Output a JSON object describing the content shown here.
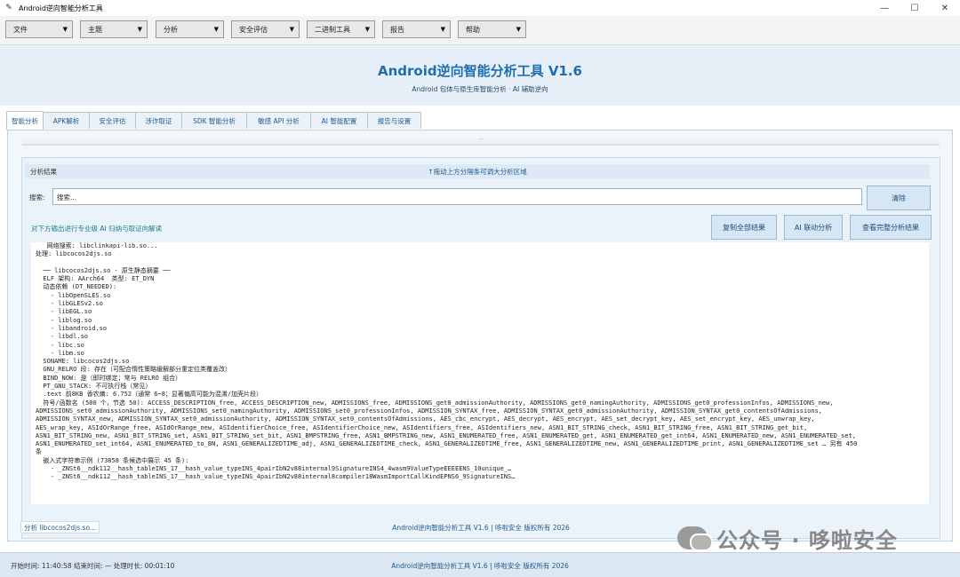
{
  "window": {
    "title": "Android逆向智能分析工具",
    "icon": "feather-icon",
    "controls": [
      "—",
      "☐",
      "✕"
    ]
  },
  "menubar": [
    {
      "label": "文件"
    },
    {
      "label": "主题"
    },
    {
      "label": "分析"
    },
    {
      "label": "安全评估"
    },
    {
      "label": "二进制工具"
    },
    {
      "label": "报告"
    },
    {
      "label": "帮助"
    }
  ],
  "banner": {
    "title": "Android逆向智能分析工具 V1.6",
    "subtitle": "Android 包体与原生库智能分析 · AI 辅助逆向"
  },
  "tabs": [
    {
      "label": "智能分析",
      "active": true
    },
    {
      "label": "APK解析"
    },
    {
      "label": "安全评估"
    },
    {
      "label": "涉诈取证"
    },
    {
      "label": "SDK 智能分析"
    },
    {
      "label": "敏感 API 分析"
    },
    {
      "label": "AI 智能配置"
    },
    {
      "label": "报告与设置"
    }
  ],
  "analysis": {
    "header_label": "分析结果",
    "splitter_hint": "↑拖动上方分隔条可调大分析区域",
    "search_label": "搜索:",
    "search_placeholder": "搜索...",
    "clear_button": "清除",
    "instruction": "对下方输出进行专业级 AI 归纳与取证向解读",
    "copy_button": "复制全部结果",
    "ai_button": "AI 联动分析",
    "view_button": "查看完整分析结果",
    "output_lines": [
      "   网络搜索: libclinkapi-lib.so...",
      "处理: libcocos2djs.so",
      "",
      "  ── libcocos2djs.so · 原生静态摘要 ──",
      "  ELF 架构: AArch64  类型: ET_DYN",
      "  动态依赖 (DT_NEEDED):",
      "    - libOpenSLES.so",
      "    - libGLESv2.so",
      "    - libEGL.so",
      "    - liblog.so",
      "    - libandroid.so",
      "    - libdl.so",
      "    - libc.so",
      "    - libm.so",
      "  SONAME: libcocos2djs.so",
      "  GNU_RELRO 段: 存在（可配合惰性策略缓解部分重定位类覆盖改）",
      "  BIND_NOW: 是（即时绑定；常与 RELRO 组合）",
      "  PT_GNU_STACK: 不可执行栈（常见）",
      "  .text 前8KB 香农熵: 6.752（通常 6~8；显著偏高可能为混淆/加壳片段）",
      "  符号/函数名 (500 个，节选 50): ACCESS_DESCRIPTION_free, ACCESS_DESCRIPTION_new, ADMISSIONS_free, ADMISSIONS_get0_admissionAuthority, ADMISSIONS_get0_namingAuthority, ADMISSIONS_get0_professionInfos, ADMISSIONS_new,",
      "ADMISSIONS_set0_admissionAuthority, ADMISSIONS_set0_namingAuthority, ADMISSIONS_set0_professionInfos, ADMISSION_SYNTAX_free, ADMISSION_SYNTAX_get0_admissionAuthority, ADMISSION_SYNTAX_get0_contentsOfAdmissions,",
      "ADMISSION_SYNTAX_new, ADMISSION_SYNTAX_set0_admissionAuthority, ADMISSION_SYNTAX_set0_contentsOfAdmissions, AES_cbc_encrypt, AES_decrypt, AES_encrypt, AES_set_decrypt_key, AES_set_encrypt_key, AES_unwrap_key,",
      "AES_wrap_key, ASIdOrRange_free, ASIdOrRange_new, ASIdentifierChoice_free, ASIdentifierChoice_new, ASIdentifiers_free, ASIdentifiers_new, ASN1_BIT_STRING_check, ASN1_BIT_STRING_free, ASN1_BIT_STRING_get_bit,",
      "ASN1_BIT_STRING_new, ASN1_BIT_STRING_set, ASN1_BIT_STRING_set_bit, ASN1_BMPSTRING_free, ASN1_BMPSTRING_new, ASN1_ENUMERATED_free, ASN1_ENUMERATED_get, ASN1_ENUMERATED_get_int64, ASN1_ENUMERATED_new, ASN1_ENUMERATED_set,",
      "ASN1_ENUMERATED_set_int64, ASN1_ENUMERATED_to_BN, ASN1_GENERALIZEDTIME_adj, ASN1_GENERALIZEDTIME_check, ASN1_GENERALIZEDTIME_free, ASN1_GENERALIZEDTIME_new, ASN1_GENERALIZEDTIME_print, ASN1_GENERALIZEDTIME_set … 另有 450",
      "条",
      "  嵌入式字符串示例 (73858 条候选中展示 45 条):",
      "    - _ZNSt6__ndk112__hash_tableINS_17__hash_value_typeINS_4pairIbN2v88internal9SignatureINS4_4wasm9ValueTypeEEEEENS_10unique_…",
      "    - _ZNSt6__ndk112__hash_tableINS_17__hash_value_typeINS_4pairIbN2v88internal8compiler18WasmImportCallKindEPNS6_9SignatureINS…"
    ]
  },
  "status": {
    "left": "分析 libcocos2djs.so...",
    "center": "Android逆向智能分析工具 V1.6 | 哆啦安全 版权所有 2026"
  },
  "watermark": {
    "text": "公众号 · 哆啦安全",
    "icon": "wechat-icon"
  },
  "footer": {
    "left": "开始时间: 11:40:58   结束时间: —   处理时长: 00:01:10",
    "center": "Android逆向智能分析工具 V1.6 | 哆啦安全 版权所有 2026"
  }
}
